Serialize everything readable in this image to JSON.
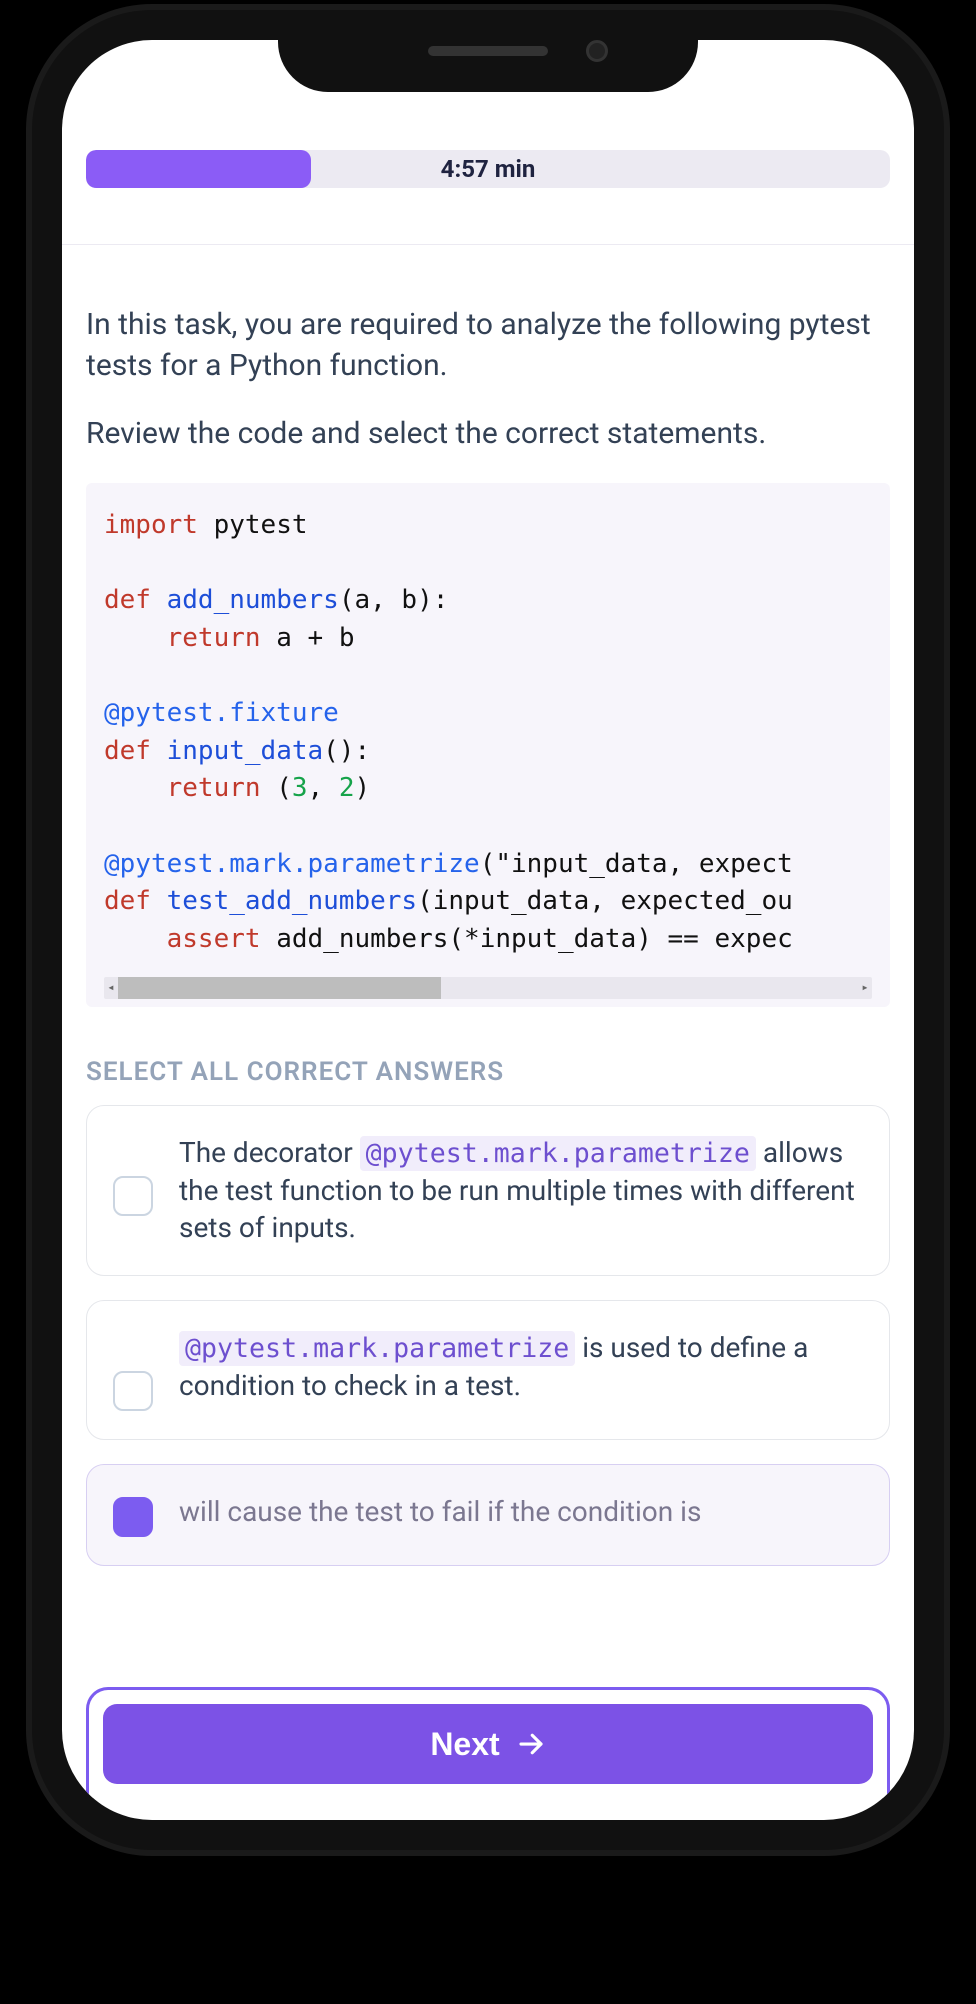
{
  "timer": {
    "text": "4:57 min",
    "progress_percent": 28
  },
  "question": {
    "p1": "In this task, you are required to analyze the following pytest tests for a Python function.",
    "p2": "Review the code and select the correct statements."
  },
  "code": {
    "l1_import": "import",
    "l1_rest": " pytest",
    "l3_def": "def",
    "l3_fn": " add_numbers",
    "l3_rest": "(a, b):",
    "l4_indent": "    ",
    "l4_return": "return",
    "l4_rest": " a + b",
    "l6_dec": "@pytest.fixture",
    "l7_def": "def",
    "l7_fn": " input_data",
    "l7_rest": "():",
    "l8_indent": "    ",
    "l8_return": "return",
    "l8_paren_open": " (",
    "l8_n1": "3",
    "l8_comma": ", ",
    "l8_n2": "2",
    "l8_paren_close": ")",
    "l10_dec_prefix": "@pytest.mark.parametrize",
    "l10_paren": "(",
    "l10_str": "\"input_data, expect",
    "l11_def": "def",
    "l11_fn": " test_add_numbers",
    "l11_rest": "(input_data, expected_ou",
    "l12_indent": "    ",
    "l12_assert": "assert",
    "l12_rest": " add_numbers(*input_data) == expec"
  },
  "answers": {
    "heading": "SELECT ALL CORRECT ANSWERS",
    "a1_pre": "The decorator ",
    "a1_code": "@pytest.mark.parametrize",
    "a1_post": " allows the test function to be run multiple times with different sets of inputs.",
    "a2_code": "@pytest.mark.parametrize",
    "a2_post": " is used to define a condition to check in a test.",
    "a3_text": "will cause the test to fail if the condition is"
  },
  "next": {
    "label": "Next"
  }
}
